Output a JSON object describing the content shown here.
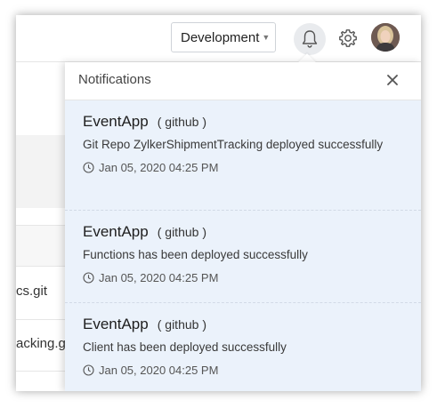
{
  "header": {
    "environment": "Development"
  },
  "background_list": {
    "rows": [
      "cs.git",
      "acking.git"
    ]
  },
  "notifications": {
    "title": "Notifications",
    "items": [
      {
        "app": "EventApp",
        "source": "( github )",
        "message": "Git Repo ZylkerShipmentTracking deployed successfully",
        "time": "Jan 05, 2020 04:25 PM"
      },
      {
        "app": "EventApp",
        "source": "( github )",
        "message": "Functions has been deployed successfully",
        "time": "Jan 05, 2020 04:25 PM"
      },
      {
        "app": "EventApp",
        "source": "( github )",
        "message": "Client has been deployed successfully",
        "time": "Jan 05, 2020 04:25 PM"
      }
    ]
  },
  "colors": {
    "notification_bg": "#ebf2fb",
    "bell_active_bg": "#e9ebee"
  }
}
